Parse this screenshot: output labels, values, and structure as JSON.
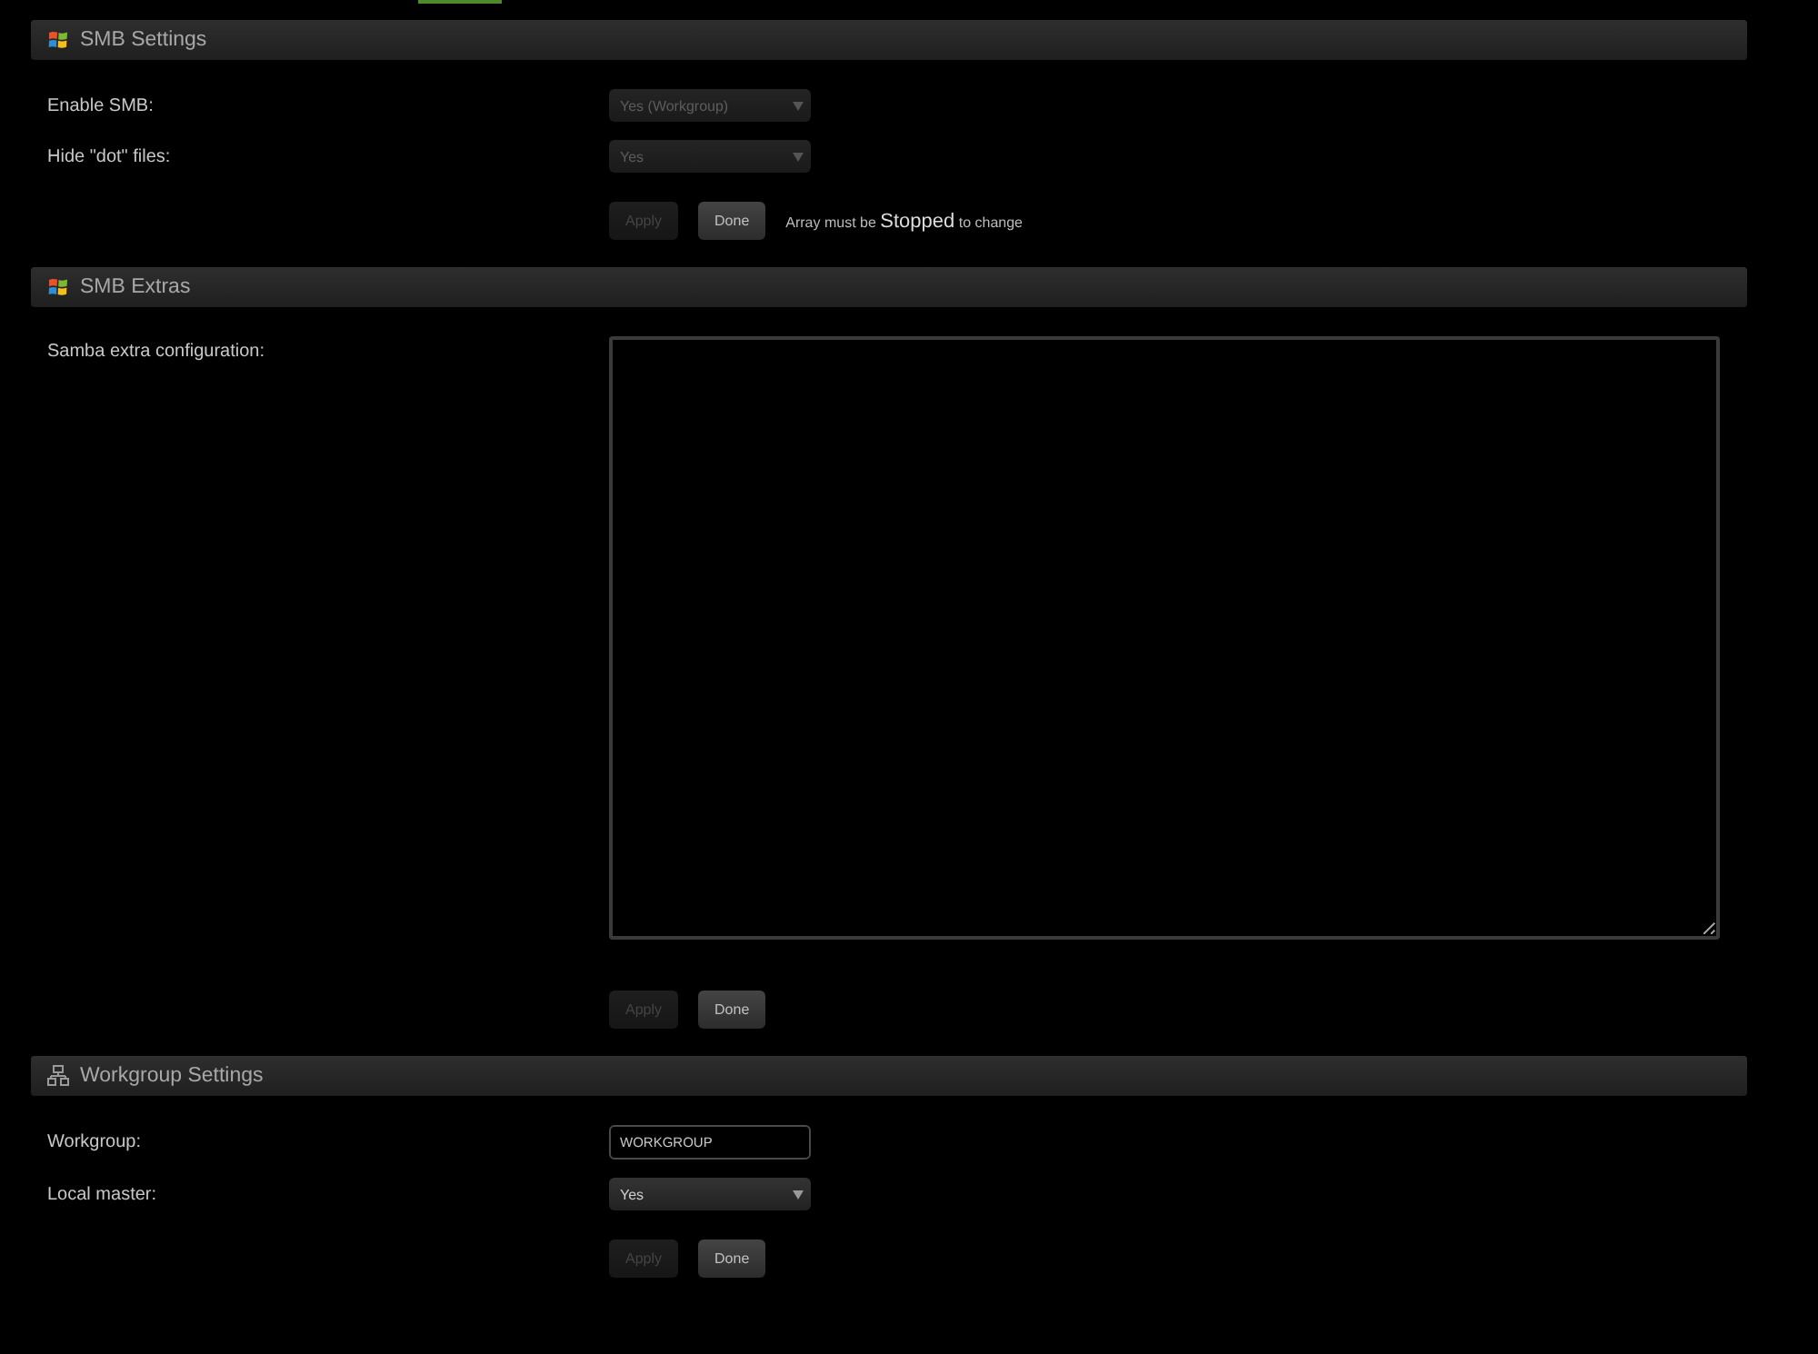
{
  "sections": [
    {
      "title": "SMB Settings",
      "kind": "smb",
      "fields": [
        {
          "kind": "select",
          "label": "Enable SMB:",
          "value": "Yes (Workgroup)",
          "disabled": true
        },
        {
          "kind": "select",
          "label": "Hide \"dot\" files:",
          "value": "Yes",
          "disabled": true
        }
      ],
      "buttons": [
        {
          "label": "Apply",
          "disabled": true
        },
        {
          "label": "Done",
          "disabled": false
        }
      ],
      "note": "Array must be **Stopped** to change"
    },
    {
      "title": "SMB Extras",
      "kind": "smb",
      "fields": [
        {
          "kind": "textarea",
          "label": "Samba extra configuration:"
        }
      ],
      "buttons": [
        {
          "label": "Apply",
          "disabled": true
        },
        {
          "label": "Done",
          "disabled": false
        }
      ]
    },
    {
      "title": "Workgroup Settings",
      "kind": "network",
      "fields": [
        {
          "kind": "text",
          "label": "Workgroup:",
          "value": "WORKGROUP"
        },
        {
          "kind": "select",
          "label": "Local master:",
          "value": "Yes",
          "disabled": false
        }
      ],
      "buttons": [
        {
          "label": "Apply",
          "disabled": true
        },
        {
          "label": "Done",
          "disabled": false
        }
      ]
    }
  ]
}
